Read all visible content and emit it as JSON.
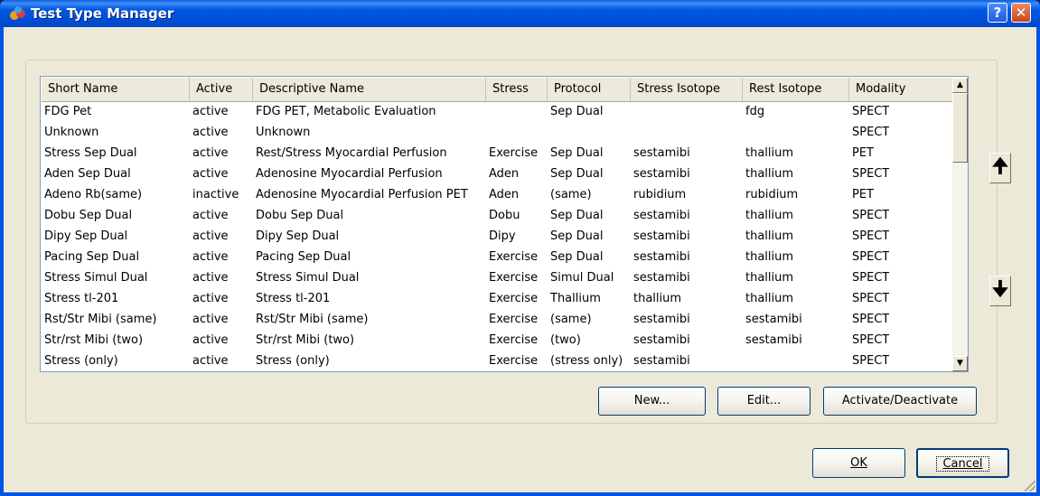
{
  "window": {
    "title": "Test Type Manager",
    "help_label": "?",
    "close_label": "✕"
  },
  "table": {
    "columns": [
      "Short Name",
      "Active",
      "Descriptive Name",
      "Stress",
      "Protocol",
      "Stress Isotope",
      "Rest Isotope",
      "Modality"
    ],
    "rows": [
      [
        "FDG Pet",
        "active",
        "FDG PET, Metabolic Evaluation",
        "",
        "Sep Dual",
        "",
        "fdg",
        "SPECT"
      ],
      [
        "Unknown",
        "active",
        "Unknown",
        "",
        "",
        "",
        "",
        "SPECT"
      ],
      [
        "Stress Sep Dual",
        "active",
        "Rest/Stress Myocardial Perfusion",
        "Exercise",
        "Sep Dual",
        "sestamibi",
        "thallium",
        "PET"
      ],
      [
        "Aden Sep Dual",
        "active",
        "Adenosine Myocardial Perfusion",
        "Aden",
        "Sep Dual",
        "sestamibi",
        "thallium",
        "SPECT"
      ],
      [
        "Adeno Rb(same)",
        "inactive",
        "Adenosine Myocardial Perfusion PET",
        "Aden",
        "(same)",
        "rubidium",
        "rubidium",
        "PET"
      ],
      [
        "Dobu Sep Dual",
        "active",
        "Dobu Sep Dual",
        "Dobu",
        "Sep Dual",
        "sestamibi",
        "thallium",
        "SPECT"
      ],
      [
        "Dipy Sep Dual",
        "active",
        "Dipy Sep Dual",
        "Dipy",
        "Sep Dual",
        "sestamibi",
        "thallium",
        "SPECT"
      ],
      [
        "Pacing Sep Dual",
        "active",
        "Pacing Sep Dual",
        "Exercise",
        "Sep Dual",
        "sestamibi",
        "thallium",
        "SPECT"
      ],
      [
        "Stress Simul Dual",
        "active",
        "Stress Simul Dual",
        "Exercise",
        "Simul Dual",
        "sestamibi",
        "thallium",
        "SPECT"
      ],
      [
        "Stress tl-201",
        "active",
        "Stress tl-201",
        "Exercise",
        "Thallium",
        "thallium",
        "thallium",
        "SPECT"
      ],
      [
        "Rst/Str Mibi (same)",
        "active",
        "Rst/Str Mibi (same)",
        "Exercise",
        "(same)",
        "sestamibi",
        "sestamibi",
        "SPECT"
      ],
      [
        "Str/rst Mibi (two)",
        "active",
        "Str/rst Mibi (two)",
        "Exercise",
        "(two)",
        "sestamibi",
        "sestamibi",
        "SPECT"
      ],
      [
        "Stress (only)",
        "active",
        "Stress (only)",
        "Exercise",
        "(stress only)",
        "sestamibi",
        "",
        "SPECT"
      ]
    ]
  },
  "buttons": {
    "new": "New...",
    "edit": "Edit...",
    "activate": "Activate/Deactivate",
    "ok": "OK",
    "cancel": "Cancel",
    "move_up": "🠉",
    "move_down": "🠋"
  },
  "icons": {
    "app": "test-tube-icon",
    "up": "arrow-up-icon",
    "down": "arrow-down-icon"
  }
}
